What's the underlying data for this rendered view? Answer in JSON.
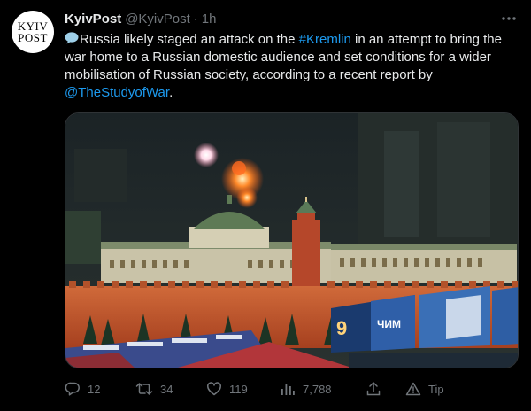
{
  "tweet": {
    "avatar_line1": "KYIV",
    "avatar_line2": "POST",
    "author_name": "KyivPost",
    "author_handle": "@KyivPost",
    "separator": "·",
    "time": "1h",
    "text_part1": "Russia likely staged an attack on the ",
    "hashtag": "#Kremlin",
    "text_part2": " in an attempt to bring the war home to a Russian domestic audience and set conditions for a wider mobilisation of Russian society, according to a recent report by ",
    "mention": "@TheStudyofWar",
    "text_part3": ".",
    "media_screen_label": "ЧИМ",
    "media_number": "9"
  },
  "actions": {
    "reply_count": "12",
    "retweet_count": "34",
    "like_count": "119",
    "views_count": "7,788",
    "tip_label": "Tip"
  },
  "icons": {
    "more": "more-icon",
    "reply": "reply-icon",
    "retweet": "retweet-icon",
    "like": "heart-icon",
    "views": "views-icon",
    "share": "share-icon",
    "tip": "tip-icon",
    "speech": "speech-balloon-icon"
  },
  "colors": {
    "background": "#000000",
    "text": "#e7e9ea",
    "secondary": "#71767b",
    "link": "#1d9bf0"
  }
}
